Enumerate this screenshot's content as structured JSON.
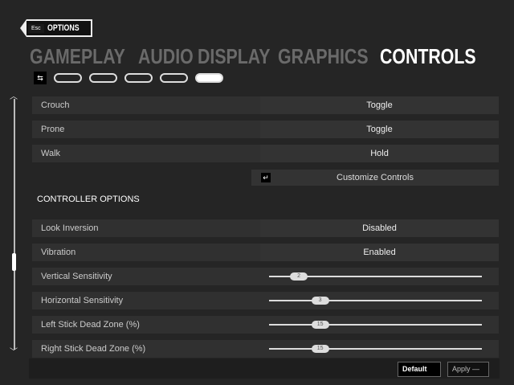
{
  "header": {
    "esc_label": "Esc",
    "title": "OPTIONS"
  },
  "tabs": [
    {
      "label": "GAMEPLAY",
      "active": false
    },
    {
      "label": "AUDIO",
      "active": false
    },
    {
      "label": "DISPLAY",
      "active": false
    },
    {
      "label": "GRAPHICS",
      "active": false
    },
    {
      "label": "CONTROLS",
      "active": true
    }
  ],
  "subpage_active_index": 4,
  "rows": [
    {
      "label": "Crouch",
      "value": "Toggle"
    },
    {
      "label": "Prone",
      "value": "Toggle"
    },
    {
      "label": "Walk",
      "value": "Hold"
    }
  ],
  "customize_label": "Customize Controls",
  "section_title": "CONTROLLER OPTIONS",
  "controller_rows": [
    {
      "label": "Look Inversion",
      "value": "Disabled"
    },
    {
      "label": "Vibration",
      "value": "Enabled"
    }
  ],
  "sliders": [
    {
      "label": "Vertical Sensitivity",
      "value": "2",
      "fraction": 0.14
    },
    {
      "label": "Horizontal Sensitivity",
      "value": "3",
      "fraction": 0.24
    },
    {
      "label": "Left Stick Dead Zone (%)",
      "value": "15",
      "fraction": 0.24
    },
    {
      "label": "Right Stick Dead Zone (%)",
      "value": "15",
      "fraction": 0.24
    }
  ],
  "footer": {
    "default_label": "Default",
    "apply_label": "Apply"
  }
}
